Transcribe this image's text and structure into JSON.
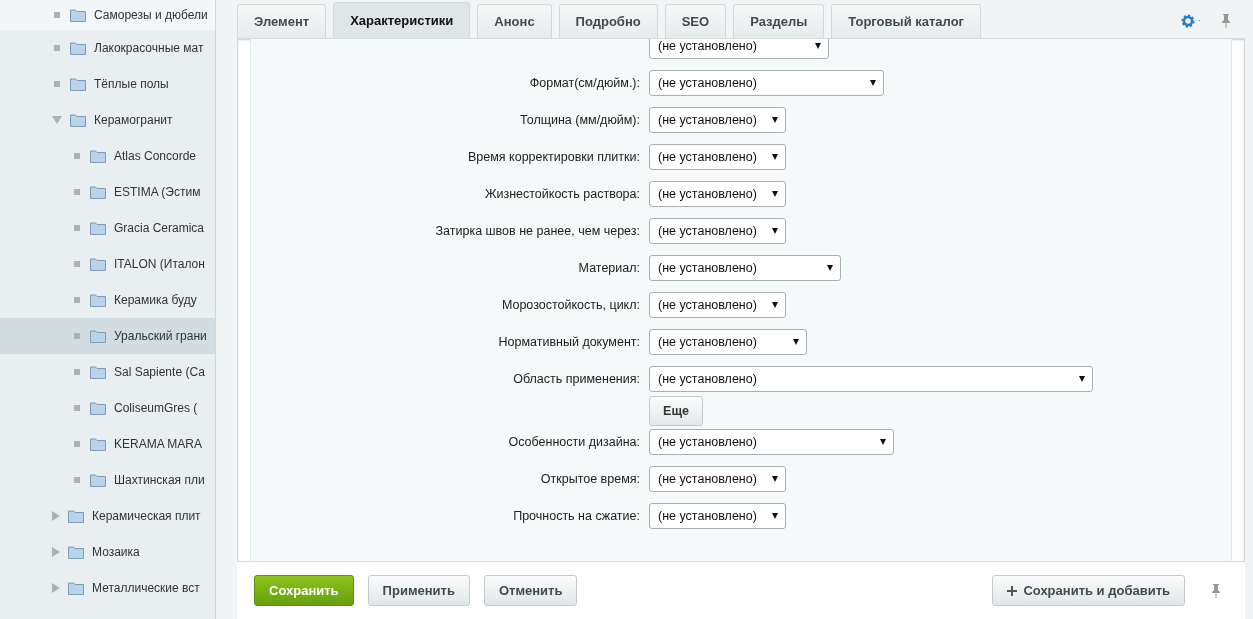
{
  "sidebar": {
    "items": [
      {
        "label": "Саморезы и дюбели",
        "selected": false
      },
      {
        "label": "Лакокрасочные мат",
        "selected": false
      },
      {
        "label": "Тёплые полы",
        "selected": false
      },
      {
        "label": "Керамогранит",
        "selected": false,
        "expanded": true,
        "children": [
          {
            "label": "Atlas Concorde",
            "selected": false
          },
          {
            "label": "ESTIMA (Эстим",
            "selected": false
          },
          {
            "label": "Gracia Ceramica",
            "selected": false
          },
          {
            "label": "ITALON (Италон",
            "selected": false
          },
          {
            "label": "Керамика буду",
            "selected": false
          },
          {
            "label": "Уральский грани",
            "selected": true
          },
          {
            "label": "Sal Sapiente (Са",
            "selected": false
          },
          {
            "label": "ColiseumGres (",
            "selected": false
          },
          {
            "label": "KERAMA MARA",
            "selected": false
          },
          {
            "label": "Шахтинская пли",
            "selected": false
          }
        ]
      },
      {
        "label": "Керамическая плит",
        "selected": false,
        "expanded": false
      },
      {
        "label": "Мозаика",
        "selected": false,
        "expanded": false
      },
      {
        "label": "Металлические вст",
        "selected": false,
        "expanded": false
      }
    ]
  },
  "tabs": [
    {
      "label": "Элемент",
      "selected": false
    },
    {
      "label": "Характеристики",
      "selected": true
    },
    {
      "label": "Анонс",
      "selected": false
    },
    {
      "label": "Подробно",
      "selected": false
    },
    {
      "label": "SEO",
      "selected": false
    },
    {
      "label": "Разделы",
      "selected": false
    },
    {
      "label": "Торговый каталог",
      "selected": false
    }
  ],
  "fields": [
    {
      "value": "(не установлено)"
    },
    {
      "label": "Формат(см/дюйм.):",
      "value": "(не установлено)"
    },
    {
      "label": "Толщина (мм/дюйм):",
      "value": "(не установлено)"
    },
    {
      "label": "Время корректировки плитки:",
      "value": "(не установлено)"
    },
    {
      "label": "Жизнестойкость раствора:",
      "value": "(не установлено)"
    },
    {
      "label": "Затирка швов не ранее, чем через:",
      "value": "(не установлено)"
    },
    {
      "label": "Материал:",
      "value": "(не установлено)"
    },
    {
      "label": "Морозостойкость, цикл:",
      "value": "(не установлено)"
    },
    {
      "label": "Нормативный документ:",
      "value": "(не установлено)"
    },
    {
      "label": "Область применения:",
      "value": "(не установлено)",
      "more_button": "Еще"
    },
    {
      "label": "Особенности дизайна:",
      "value": "(не установлено)"
    },
    {
      "label": "Открытое время:",
      "value": "(не установлено)"
    },
    {
      "label": "Прочность на сжатие:",
      "value": "(не установлено)"
    }
  ],
  "footer": {
    "buttons": [
      {
        "label": "Сохранить",
        "kind": "primary"
      },
      {
        "label": "Применить",
        "kind": "normal"
      },
      {
        "label": "Отменить",
        "kind": "normal"
      }
    ],
    "save_and_add": "Сохранить и добавить"
  }
}
